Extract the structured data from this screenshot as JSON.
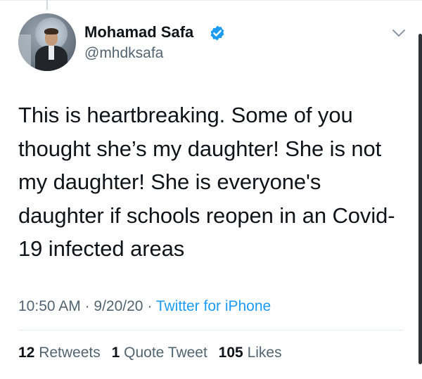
{
  "tweet": {
    "author": {
      "name": "Mohamad Safa",
      "handle": "@mhdksafa",
      "verified": true
    },
    "text": "This is heartbreaking. Some of you thought she’s my daughter! She is not my daughter! She is everyone's daughter if schools reopen in an Covid-19 infected areas",
    "time": "10:50 AM",
    "date": "9/20/20",
    "separator": "·",
    "source": "Twitter for iPhone"
  },
  "stats": {
    "retweets_count": "12",
    "retweets_label": "Retweets",
    "quote_count": "1",
    "quote_label": "Quote Tweet",
    "likes_count": "105",
    "likes_label": "Likes"
  },
  "icons": {
    "verified": "verified-badge-icon",
    "more": "chevron-down-icon"
  },
  "colors": {
    "accent": "#1d9bf0",
    "text": "#0f1419",
    "secondary": "#536471",
    "divider": "#e6ecf0"
  }
}
